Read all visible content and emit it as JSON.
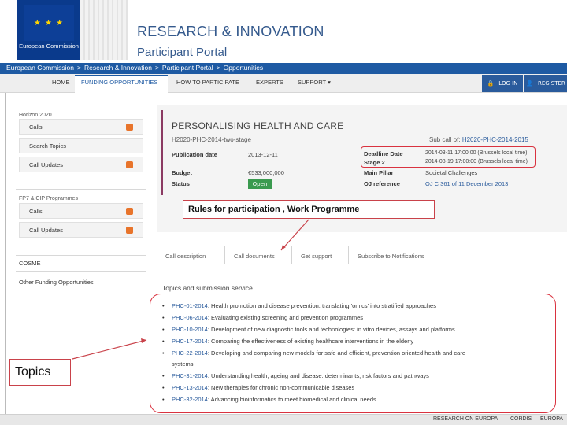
{
  "header": {
    "logo_text": "European Commission",
    "logo_stars": "★ ★ ★",
    "site_title": "RESEARCH & INNOVATION",
    "site_subtitle": "Participant Portal"
  },
  "breadcrumb": [
    "European Commission",
    "Research & Innovation",
    "Participant Portal",
    "Opportunities"
  ],
  "breadcrumb_separator": ">",
  "nav": {
    "items": [
      "HOME",
      "FUNDING OPPORTUNITIES",
      "HOW TO PARTICIPATE",
      "EXPERTS",
      "SUPPORT ▾"
    ],
    "active_index": 1,
    "login": "LOG IN",
    "register": "REGISTER"
  },
  "sidebar": {
    "group1_title": "Horizon 2020",
    "group1_items": [
      "Calls",
      "Search Topics",
      "Call Updates"
    ],
    "group2_title": "FP7 & CIP Programmes",
    "group2_items": [
      "Calls",
      "Call Updates"
    ],
    "extra_items": [
      "COSME",
      "Other Funding Opportunities"
    ]
  },
  "call": {
    "title": "PERSONALISING HEALTH AND CARE",
    "identifier": "H2020-PHC-2014-two-stage",
    "sub_call_label": "Sub call of:",
    "sub_call_value": "H2020-PHC-2014-2015",
    "publication_label": "Publication date",
    "publication_value": "2013-12-11",
    "budget_label": "Budget",
    "budget_value": "€533,000,000",
    "status_label": "Status",
    "status_value": "Open",
    "deadline_label": "Deadline Date",
    "deadline_value": "2014-03-11 17:00:00 (Brussels local time)",
    "stage2_label": "Stage 2",
    "stage2_value": "2014-08-19 17:00:00 (Brussels local time)",
    "pillar_label": "Main Pillar",
    "pillar_value": "Societal Challenges",
    "oj_label": "OJ reference",
    "oj_value": "OJ C 361 of 11 December 2013"
  },
  "tabs": [
    "Call description",
    "Call documents",
    "Get support",
    "Subscribe to Notifications"
  ],
  "topics": {
    "heading": "Topics and submission service",
    "items": [
      {
        "code": "PHC-01-2014",
        "text": "Health promotion and disease prevention: translating 'omics' into stratified approaches"
      },
      {
        "code": "PHC-06-2014",
        "text": "Evaluating existing screening and prevention programmes"
      },
      {
        "code": "PHC-10-2014",
        "text": "Development of new diagnostic tools and technologies: in vitro devices, assays and platforms"
      },
      {
        "code": "PHC-17-2014",
        "text": "Comparing the effectiveness of existing healthcare interventions in the elderly"
      },
      {
        "code": "PHC-22-2014",
        "text": "Developing and comparing new models for safe and efficient, prevention oriented health and care"
      },
      {
        "code": "",
        "text": "systems"
      },
      {
        "code": "PHC-31-2014",
        "text": "Understanding health, ageing and disease: determinants, risk factors and pathways"
      },
      {
        "code": "PHC-13-2014",
        "text": "New therapies for chronic non-communicable diseases"
      },
      {
        "code": "PHC-32-2014",
        "text": "Advancing bioinformatics to meet biomedical and clinical needs"
      }
    ]
  },
  "annotations": {
    "rules": "Rules for participation , Work Programme",
    "topics": "Topics",
    "color": "#d9323f"
  },
  "footer": [
    "RESEARCH ON EUROPA",
    "CORDIS",
    "EUROPA"
  ],
  "colors": {
    "brand_blue": "#1e5aa3",
    "title_blue": "#355a8d",
    "accent_purple": "#8b3a62",
    "status_green": "#3a9a4f",
    "rss_orange": "#e8742b"
  }
}
